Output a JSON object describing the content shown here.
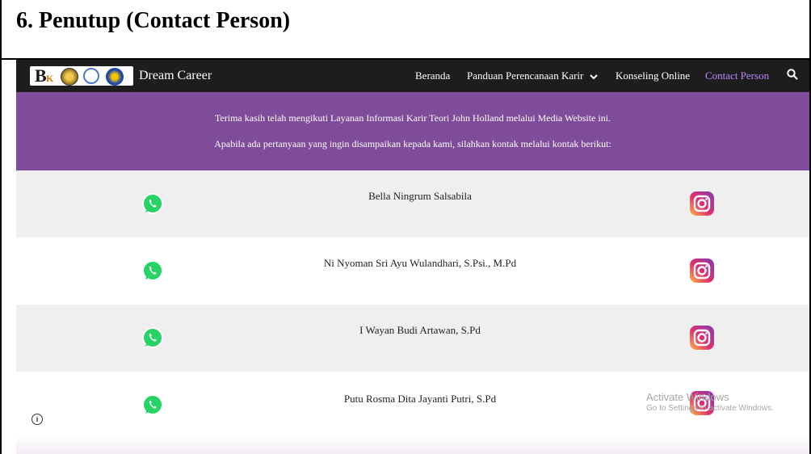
{
  "document": {
    "heading": "6. Penutup (Contact Person)"
  },
  "navbar": {
    "brand": "Dream Career",
    "logo_letter": "B",
    "logo_small": "K",
    "items": [
      {
        "label": "Beranda"
      },
      {
        "label": "Panduan Perencanaan Karir"
      },
      {
        "label": "Konseling Online"
      },
      {
        "label": "Contact Person"
      }
    ],
    "dropdown_icon": "chevron-down-icon",
    "search_icon": "search-icon",
    "active_color": "#c085ff",
    "background": "#1d1d1d"
  },
  "banner": {
    "line1": "Terima kasih telah mengikuti Layanan Informasi Karir Teori John Holland melalui Media Website ini.",
    "line2": "Apabila ada pertanyaan yang ingin disampaikan kepada kami, silahkan kontak melalui kontak berikut:",
    "background": "#7e4c99"
  },
  "contacts": [
    {
      "name": "Bella Ningrum Salsabila"
    },
    {
      "name": "Ni Nyoman Sri Ayu Wulandhari, S.Psi., M.Pd"
    },
    {
      "name": "I Wayan Budi Artawan, S.Pd"
    },
    {
      "name": "Putu Rosma Dita Jayanti Putri, S.Pd"
    }
  ],
  "icons": {
    "whatsapp": "whatsapp-icon",
    "instagram": "instagram-icon",
    "info": "info-icon"
  },
  "watermark": {
    "line1": "Activate Windows",
    "line2": "Go to Settings to activate Windows."
  }
}
